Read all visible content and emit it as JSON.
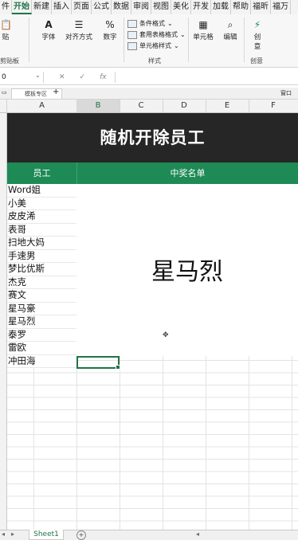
{
  "ribbon_tabs": [
    "件",
    "开始",
    "新建",
    "插入",
    "页面",
    "公式",
    "数据",
    "审阅",
    "视图",
    "美化",
    "开发",
    "加载",
    "帮助",
    "福昕",
    "福万"
  ],
  "ribbon": {
    "paste_label": "贴",
    "clipboard_label": "剪贴板",
    "font_label": "字体",
    "align_label": "对齐方式",
    "number_label": "数字",
    "style_group_label": "样式",
    "cond_format": "条件格式",
    "table_format": "套用表格格式",
    "cell_styles": "单元格样式",
    "cells_label": "单元格",
    "edit_label": "编辑",
    "ideas_label1": "创",
    "ideas_label2": "意",
    "ideas_group": "创意"
  },
  "formula_bar": {
    "name_box": "0",
    "fx": "fx",
    "cancel": "✕",
    "confirm": "✓"
  },
  "workbook_tab": "模板专区",
  "workbook_tab_right": "窗口",
  "columns": [
    "A",
    "B",
    "C",
    "D",
    "E",
    "F"
  ],
  "selected_column": "B",
  "title": "随机开除员工",
  "headers": {
    "employee": "员工",
    "winner_list": "中奖名单"
  },
  "employees": [
    "Word姐",
    "小美",
    "皮皮浠",
    "表哥",
    "扫地大妈",
    "手速男",
    "梦比优斯",
    "杰克",
    "赛文",
    "星马豪",
    "星马烈",
    "泰罗",
    "雷欧",
    "冲田海"
  ],
  "winner": "星马烈",
  "sheet_tab": "Sheet1"
}
